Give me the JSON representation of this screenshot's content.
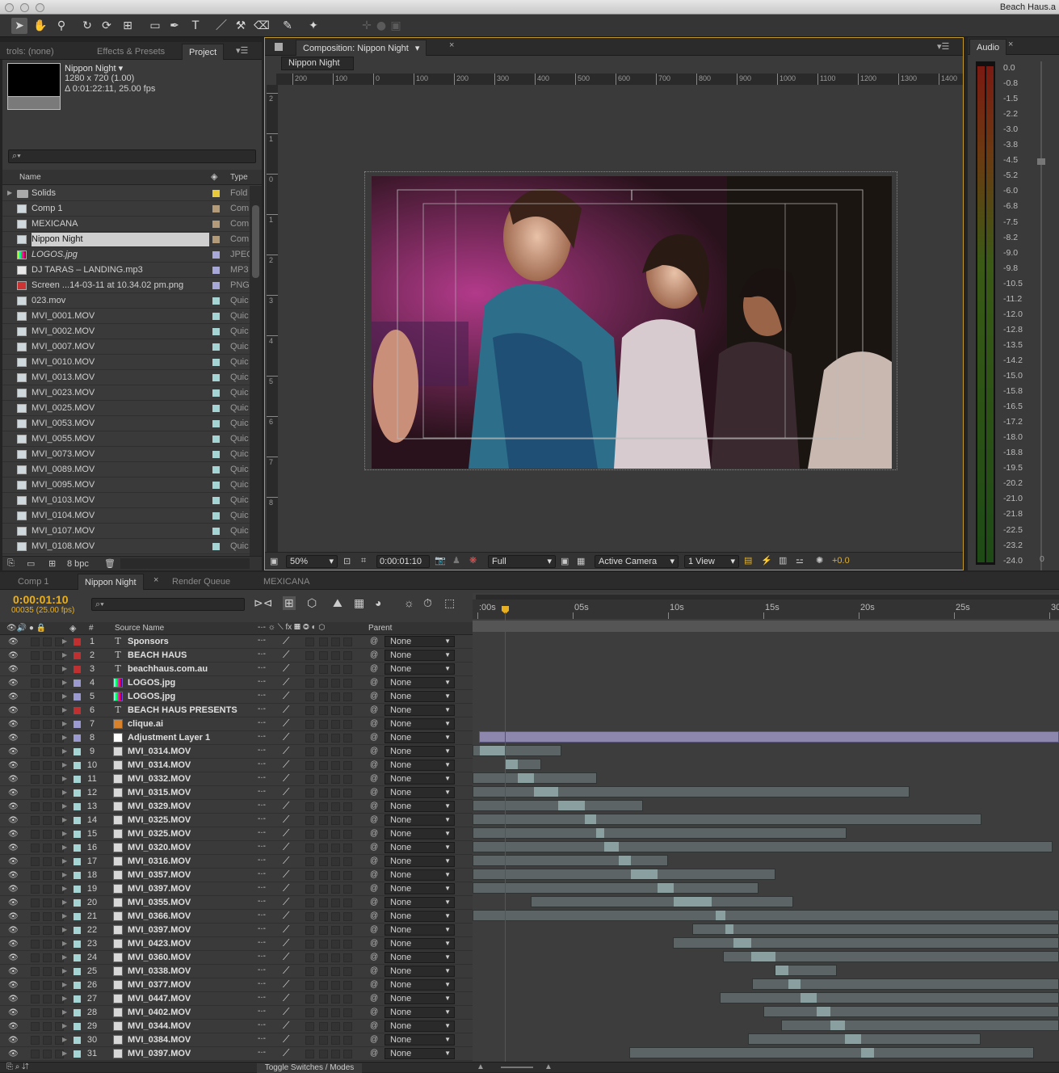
{
  "app": {
    "title": "Beach Haus.a"
  },
  "tools": {
    "icons": [
      "selection-icon",
      "hand-icon",
      "zoom-icon",
      "rotate-icon",
      "camera-orbit-icon",
      "pan-behind-icon",
      "rectangle-icon",
      "pen-icon",
      "type-icon",
      "brush-icon",
      "clone-stamp-icon",
      "eraser-icon",
      "roto-brush-icon",
      "puppet-pin-icon",
      "axis-local-icon",
      "axis-world-icon",
      "axis-view-icon"
    ],
    "glyphs": [
      "➤",
      "✋",
      "⚲",
      "↻",
      "⟳",
      "⊞",
      "▭",
      "✒",
      "T",
      "／",
      "⚒",
      "⌫",
      "✎",
      "✦",
      "✛",
      "●",
      "▣"
    ]
  },
  "project_panel": {
    "tabs": [
      "trols: (none)",
      "Effects & Presets",
      "Project"
    ],
    "comp_name": "Nippon Night ▾",
    "comp_size": "1280 x 720 (1.00)",
    "comp_duration": "Δ 0:01:22:11, 25.00 fps",
    "search_placeholder": "⌕▾",
    "col_name": "Name",
    "col_type": "Type",
    "items": [
      {
        "name": "Solids",
        "type": "Fold",
        "color": "#e8c93a",
        "kind": "folder"
      },
      {
        "name": "Comp 1",
        "type": "Com",
        "color": "#b39b7a",
        "kind": "comp"
      },
      {
        "name": "MEXICANA",
        "type": "Com",
        "color": "#b39b7a",
        "kind": "comp"
      },
      {
        "name": "Nippon Night",
        "type": "Com",
        "color": "#b39b7a",
        "kind": "comp",
        "selected": true
      },
      {
        "name": "LOGOS.jpg",
        "type": "JPEC",
        "color": "#a8a8d8",
        "kind": "image",
        "italic": true
      },
      {
        "name": "DJ TARAS – LANDING.mp3",
        "type": "MP3",
        "color": "#a8a8d8",
        "kind": "audio"
      },
      {
        "name": "Screen ...14-03-11 at 10.34.02 pm.png",
        "type": "PNG",
        "color": "#a8a8d8",
        "kind": "png"
      },
      {
        "name": "023.mov",
        "type": "Quic",
        "color": "#a5d4d4",
        "kind": "mov"
      },
      {
        "name": "MVI_0001.MOV",
        "type": "Quic",
        "color": "#a5d4d4",
        "kind": "mov"
      },
      {
        "name": "MVI_0002.MOV",
        "type": "Quic",
        "color": "#a5d4d4",
        "kind": "mov"
      },
      {
        "name": "MVI_0007.MOV",
        "type": "Quic",
        "color": "#a5d4d4",
        "kind": "mov"
      },
      {
        "name": "MVI_0010.MOV",
        "type": "Quic",
        "color": "#a5d4d4",
        "kind": "mov"
      },
      {
        "name": "MVI_0013.MOV",
        "type": "Quic",
        "color": "#a5d4d4",
        "kind": "mov"
      },
      {
        "name": "MVI_0023.MOV",
        "type": "Quic",
        "color": "#a5d4d4",
        "kind": "mov"
      },
      {
        "name": "MVI_0025.MOV",
        "type": "Quic",
        "color": "#a5d4d4",
        "kind": "mov"
      },
      {
        "name": "MVI_0053.MOV",
        "type": "Quic",
        "color": "#a5d4d4",
        "kind": "mov"
      },
      {
        "name": "MVI_0055.MOV",
        "type": "Quic",
        "color": "#a5d4d4",
        "kind": "mov"
      },
      {
        "name": "MVI_0073.MOV",
        "type": "Quic",
        "color": "#a5d4d4",
        "kind": "mov"
      },
      {
        "name": "MVI_0089.MOV",
        "type": "Quic",
        "color": "#a5d4d4",
        "kind": "mov"
      },
      {
        "name": "MVI_0095.MOV",
        "type": "Quic",
        "color": "#a5d4d4",
        "kind": "mov"
      },
      {
        "name": "MVI_0103.MOV",
        "type": "Quic",
        "color": "#a5d4d4",
        "kind": "mov"
      },
      {
        "name": "MVI_0104.MOV",
        "type": "Quic",
        "color": "#a5d4d4",
        "kind": "mov"
      },
      {
        "name": "MVI_0107.MOV",
        "type": "Quic",
        "color": "#a5d4d4",
        "kind": "mov"
      },
      {
        "name": "MVI_0108.MOV",
        "type": "Quic",
        "color": "#a5d4d4",
        "kind": "mov"
      }
    ],
    "bpc": "8 bpc"
  },
  "comp_panel": {
    "tab": "Composition: Nippon Night",
    "breadcrumb": "Nippon Night",
    "ruler_h": [
      "200",
      "100",
      "0",
      "100",
      "200",
      "300",
      "400",
      "500",
      "600",
      "700",
      "800",
      "900",
      "1000",
      "1100",
      "1200",
      "1300",
      "1400"
    ],
    "ruler_v": [
      "2",
      "1",
      "0",
      "1",
      "2",
      "3",
      "4",
      "5",
      "6",
      "7",
      "8"
    ],
    "zoom": "50%",
    "timecode": "0:00:01:10",
    "resolution": "Full",
    "camera": "Active Camera",
    "views": "1 View",
    "exposure": "+0.0"
  },
  "audio_panel": {
    "tab": "Audio",
    "levels": [
      "0.0",
      "-0.8",
      "-1.5",
      "-2.2",
      "-3.0",
      "-3.8",
      "-4.5",
      "-5.2",
      "-6.0",
      "-6.8",
      "-7.5",
      "-8.2",
      "-9.0",
      "-9.8",
      "-10.5",
      "-11.2",
      "-12.0",
      "-12.8",
      "-13.5",
      "-14.2",
      "-15.0",
      "-15.8",
      "-16.5",
      "-17.2",
      "-18.0",
      "-18.8",
      "-19.5",
      "-20.2",
      "-21.0",
      "-21.8",
      "-22.5",
      "-23.2",
      "-24.0"
    ],
    "zero": "0"
  },
  "timeline": {
    "tabs": [
      "Comp 1",
      "Nippon Night",
      "Render Queue",
      "MEXICANA"
    ],
    "timecode": "0:00:01:10",
    "frame": "00035 (25.00 fps)",
    "search_placeholder": "⌕▾",
    "col_num": "#",
    "col_source": "Source Name",
    "col_parent": "Parent",
    "time_labels": [
      ":00s",
      "05s",
      "10s",
      "15s",
      "20s",
      "25s",
      "30s"
    ],
    "toggle": "Toggle Switches / Modes",
    "layers": [
      {
        "n": "1",
        "name": "Sponsors",
        "color": "#c03030",
        "kind": "text"
      },
      {
        "n": "2",
        "name": "BEACH HAUS",
        "color": "#c03030",
        "kind": "text"
      },
      {
        "n": "3",
        "name": "beachhaus.com.au",
        "color": "#c03030",
        "kind": "text"
      },
      {
        "n": "4",
        "name": "LOGOS.jpg",
        "color": "#9a9ad0",
        "kind": "image"
      },
      {
        "n": "5",
        "name": "LOGOS.jpg",
        "color": "#9a9ad0",
        "kind": "image"
      },
      {
        "n": "6",
        "name": "BEACH HAUS PRESENTS",
        "color": "#c03030",
        "kind": "text"
      },
      {
        "n": "7",
        "name": "clique.ai",
        "color": "#9a9ad0",
        "kind": "ai"
      },
      {
        "n": "8",
        "name": "Adjustment Layer 1",
        "color": "#9a9ad0",
        "kind": "adj"
      },
      {
        "n": "9",
        "name": "MVI_0314.MOV",
        "color": "#a5d4d4",
        "kind": "mov"
      },
      {
        "n": "10",
        "name": "MVI_0314.MOV",
        "color": "#a5d4d4",
        "kind": "mov"
      },
      {
        "n": "11",
        "name": "MVI_0332.MOV",
        "color": "#a5d4d4",
        "kind": "mov"
      },
      {
        "n": "12",
        "name": "MVI_0315.MOV",
        "color": "#a5d4d4",
        "kind": "mov"
      },
      {
        "n": "13",
        "name": "MVI_0329.MOV",
        "color": "#a5d4d4",
        "kind": "mov"
      },
      {
        "n": "14",
        "name": "MVI_0325.MOV",
        "color": "#a5d4d4",
        "kind": "mov"
      },
      {
        "n": "15",
        "name": "MVI_0325.MOV",
        "color": "#a5d4d4",
        "kind": "mov"
      },
      {
        "n": "16",
        "name": "MVI_0320.MOV",
        "color": "#a5d4d4",
        "kind": "mov"
      },
      {
        "n": "17",
        "name": "MVI_0316.MOV",
        "color": "#a5d4d4",
        "kind": "mov"
      },
      {
        "n": "18",
        "name": "MVI_0357.MOV",
        "color": "#a5d4d4",
        "kind": "mov"
      },
      {
        "n": "19",
        "name": "MVI_0397.MOV",
        "color": "#a5d4d4",
        "kind": "mov"
      },
      {
        "n": "20",
        "name": "MVI_0355.MOV",
        "color": "#a5d4d4",
        "kind": "mov"
      },
      {
        "n": "21",
        "name": "MVI_0366.MOV",
        "color": "#a5d4d4",
        "kind": "mov"
      },
      {
        "n": "22",
        "name": "MVI_0397.MOV",
        "color": "#a5d4d4",
        "kind": "mov"
      },
      {
        "n": "23",
        "name": "MVI_0423.MOV",
        "color": "#a5d4d4",
        "kind": "mov"
      },
      {
        "n": "24",
        "name": "MVI_0360.MOV",
        "color": "#a5d4d4",
        "kind": "mov"
      },
      {
        "n": "25",
        "name": "MVI_0338.MOV",
        "color": "#a5d4d4",
        "kind": "mov"
      },
      {
        "n": "26",
        "name": "MVI_0377.MOV",
        "color": "#a5d4d4",
        "kind": "mov"
      },
      {
        "n": "27",
        "name": "MVI_0447.MOV",
        "color": "#a5d4d4",
        "kind": "mov"
      },
      {
        "n": "28",
        "name": "MVI_0402.MOV",
        "color": "#a5d4d4",
        "kind": "mov"
      },
      {
        "n": "29",
        "name": "MVI_0344.MOV",
        "color": "#a5d4d4",
        "kind": "mov"
      },
      {
        "n": "30",
        "name": "MVI_0384.MOV",
        "color": "#a5d4d4",
        "kind": "mov"
      },
      {
        "n": "31",
        "name": "MVI_0397.MOV",
        "color": "#a5d4d4",
        "kind": "mov"
      }
    ],
    "parent_value": "None"
  }
}
